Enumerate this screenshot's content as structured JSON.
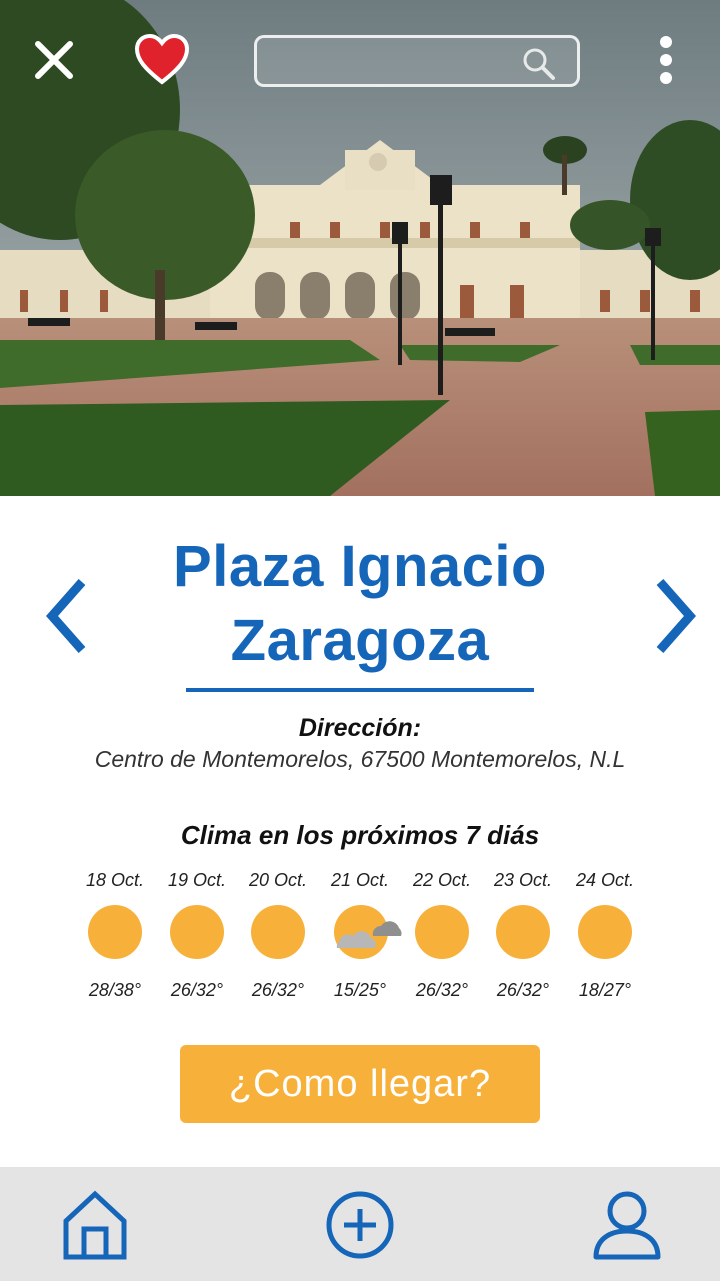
{
  "header": {
    "close_icon": "close-icon",
    "favorite_icon": "heart-icon",
    "search": {
      "placeholder": "",
      "value": "",
      "icon": "search-icon"
    },
    "menu_icon": "kebab-menu-icon"
  },
  "place": {
    "title_line1": "Plaza Ignacio",
    "title_line2": "Zaragoza",
    "address_label": "Dirección:",
    "address": "Centro de Montemorelos, 67500 Montemorelos, N.L"
  },
  "weather": {
    "title": "Clima en los próximos 7 diás",
    "days": [
      {
        "date": "18 Oct.",
        "temp": "28/38°",
        "icon": "sun"
      },
      {
        "date": "19 Oct.",
        "temp": "26/32°",
        "icon": "sun"
      },
      {
        "date": "20 Oct.",
        "temp": "26/32°",
        "icon": "sun"
      },
      {
        "date": "21 Oct.",
        "temp": "15/25°",
        "icon": "sun-cloud"
      },
      {
        "date": "22 Oct.",
        "temp": "26/32°",
        "icon": "sun"
      },
      {
        "date": "23 Oct.",
        "temp": "26/32°",
        "icon": "sun"
      },
      {
        "date": "24 Oct.",
        "temp": "18/27°",
        "icon": "sun"
      }
    ]
  },
  "cta": {
    "label": "¿Como llegar?"
  },
  "nav": {
    "items": [
      "home-icon",
      "add-icon",
      "profile-icon"
    ]
  },
  "colors": {
    "primary": "#1565b8",
    "accent": "#f7b13a",
    "sun": "#f7b13a",
    "bar": "#e4e4e4"
  }
}
